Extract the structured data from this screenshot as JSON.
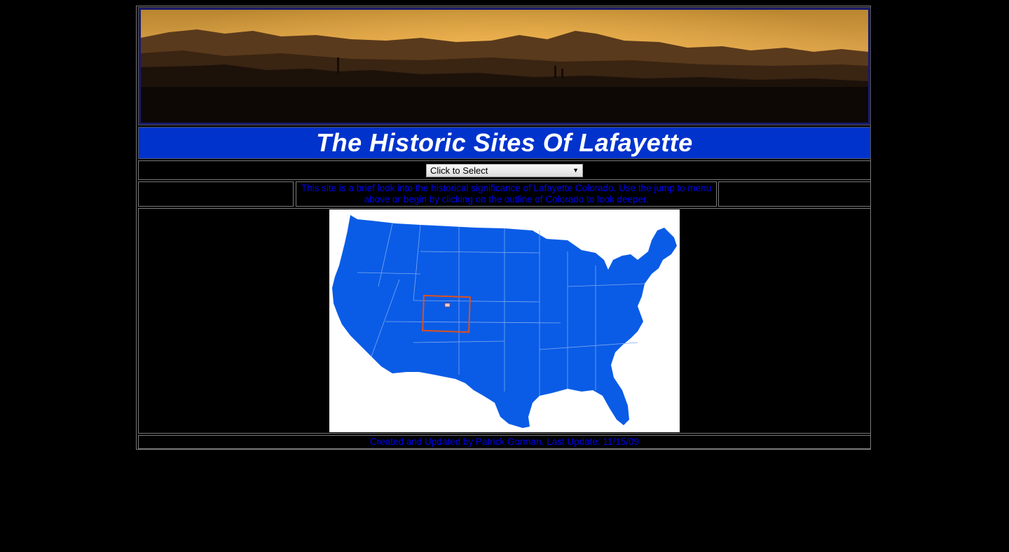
{
  "header": {
    "title": "The Historic Sites Of Lafayette"
  },
  "jump_menu": {
    "selected": "Click to Select"
  },
  "intro": {
    "text": "This site is a brief look into the historical significance of Lafayette Colorado. Use the jump to menu above or begin by clicking on the outline of Colorado to look deeper."
  },
  "map": {
    "state_fill": "#0a5ce6",
    "highlight": "#e0501a"
  },
  "footer": {
    "text": "Created and Updated by Patrick Gorman. Last Update: 11/15/09"
  },
  "colors": {
    "title_bar": "#0033cc",
    "link_blue": "#0000ee",
    "background": "#000000"
  }
}
